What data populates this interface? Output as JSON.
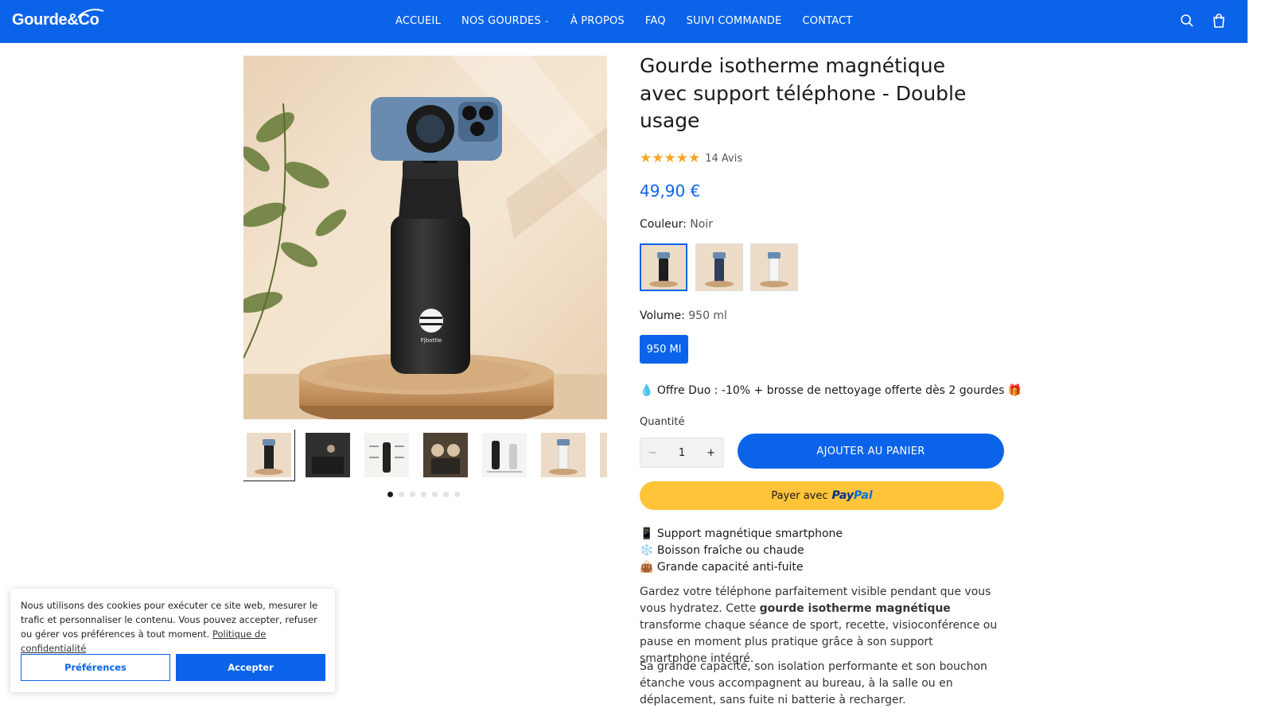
{
  "header": {
    "logo": "Gourde&Co",
    "nav": [
      {
        "label": "ACCUEIL"
      },
      {
        "label": "NOS GOURDES"
      },
      {
        "label": "À PROPOS"
      },
      {
        "label": "FAQ"
      },
      {
        "label": "SUIVI COMMANDE"
      },
      {
        "label": "CONTACT"
      }
    ],
    "icons": [
      "search-icon",
      "cart-icon"
    ]
  },
  "gallery": {
    "bottle_brand": "Fjbottle",
    "thumb_count": 7,
    "dots_total": 7,
    "dots_active": 1
  },
  "product": {
    "title": "Gourde isotherme magnétique avec support téléphone - Double usage",
    "rating": 5,
    "reviews": "14 Avis",
    "price": "49,90 €",
    "color_label": "Couleur:",
    "color_value": "Noir",
    "color_swatches": [
      "Noir",
      "Bleu",
      "Blanc"
    ],
    "volume_label": "Volume:",
    "volume_value": "950 ml",
    "volume_option": "950 Ml",
    "offer_icon": "💧",
    "offer_text": "Offre Duo : -10% + brosse de nettoyage offerte dès 2 gourdes",
    "offer_gift": "🎁",
    "quantity_label": "Quantité",
    "quantity": "1",
    "add_to_cart": "AJOUTER AU PANIER",
    "paypal_prefix": "Payer avec",
    "paypal_logo_a": "Pay",
    "paypal_logo_b": "Pal",
    "features": [
      {
        "icon": "📱",
        "text": "Support magnétique smartphone"
      },
      {
        "icon": "❄️",
        "text": "Boisson fraîche ou chaude"
      },
      {
        "icon": "👜",
        "text": "Grande capacité anti-fuite"
      }
    ],
    "desc1_before": "Gardez votre téléphone parfaitement visible pendant que vous vous hydratez. Cette ",
    "desc1_bold": "gourde isotherme magnétique",
    "desc1_after": " transforme chaque séance de sport, recette, visioconférence ou pause en moment plus pratique grâce à son support smartphone intégré.",
    "desc2": "Sa grande capacité, son isolation performante et son bouchon étanche vous accompagnent au bureau, à la salle ou en déplacement, sans fuite ni batterie à recharger."
  },
  "cookie": {
    "text": "Nous utilisons des cookies pour exécuter ce site web, mesurer le trafic et personnaliser le contenu. Vous pouvez accepter, refuser ou gérer vos préférences à tout moment.",
    "link": "Politique de confidentialité",
    "preferences": "Préférences",
    "accept": "Accepter"
  },
  "colors": {
    "brand_blue": "#0b63ea",
    "star": "#f5a623",
    "paypal_yellow": "#ffc43a"
  }
}
